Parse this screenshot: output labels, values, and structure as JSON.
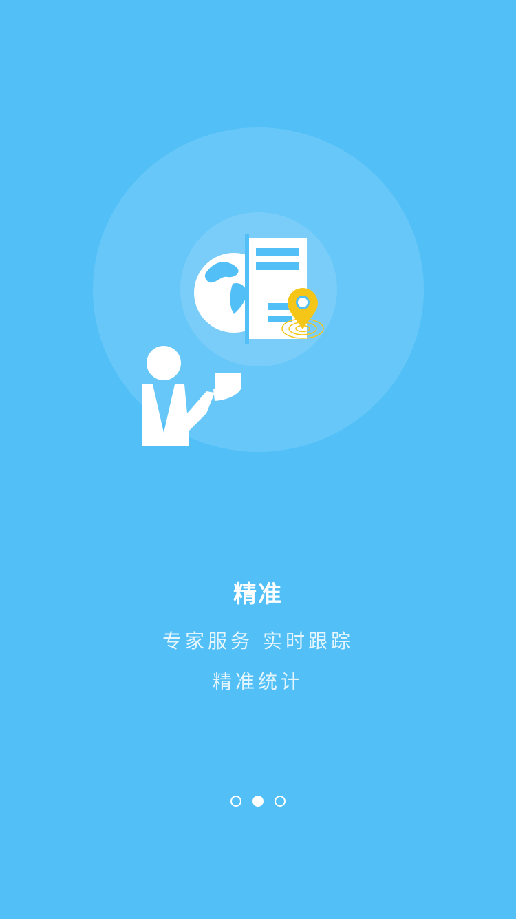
{
  "page": {
    "background_color": "#52C0F7",
    "accent_color": "#F5C518"
  },
  "hero": {
    "icons": [
      "globe-icon",
      "server-icon",
      "location-pin-icon",
      "person-icon"
    ]
  },
  "text": {
    "title": "精准",
    "line1": "专家服务 实时跟踪",
    "line2": "精准统计"
  },
  "pager": {
    "total": 3,
    "active_index": 1
  }
}
